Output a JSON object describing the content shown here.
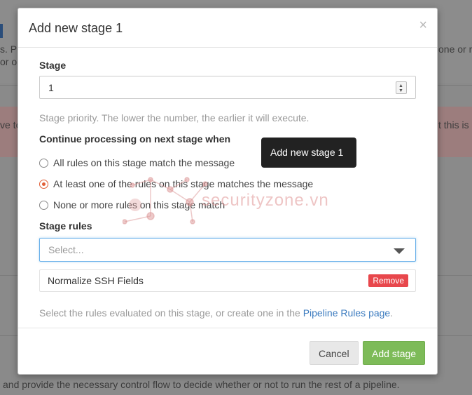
{
  "background": {
    "text_left_top1": "s. Pi",
    "text_left_top2": "or o",
    "text_right_top": "one or m",
    "alert_left": "ve to",
    "alert_right": "t this is",
    "bottom_text": "and provide the necessary control flow to decide whether or not to run the rest of a pipeline."
  },
  "modal": {
    "title": "Add new stage 1",
    "close_symbol": "×",
    "stage": {
      "label": "Stage",
      "value": "1",
      "help": "Stage priority. The lower the number, the earlier it will execute."
    },
    "continue": {
      "label": "Continue processing on next stage when",
      "options": [
        {
          "label": "All rules on this stage match the message",
          "checked": false
        },
        {
          "label": "At least one of the rules on this stage matches the message",
          "checked": true
        },
        {
          "label": "None or more rules on this stage match",
          "checked": false
        }
      ]
    },
    "stage_rules": {
      "label": "Stage rules",
      "select_placeholder": "Select...",
      "rules": [
        {
          "name": "Normalize SSH Fields",
          "remove_label": "Remove"
        }
      ],
      "help_prefix": "Select the rules evaluated on this stage, or create one in the ",
      "help_link": "Pipeline Rules page",
      "help_suffix": "."
    },
    "footer": {
      "cancel_label": "Cancel",
      "add_label": "Add stage"
    }
  },
  "tooltip": {
    "text": "Add new stage 1"
  },
  "watermark": {
    "text": "securityzone.vn"
  },
  "colors": {
    "radio_checked": "#e15f37",
    "remove_button": "#e8474c",
    "primary_button": "#7dbb58",
    "link": "#3b7bbf",
    "select_focus": "#66afe9"
  }
}
